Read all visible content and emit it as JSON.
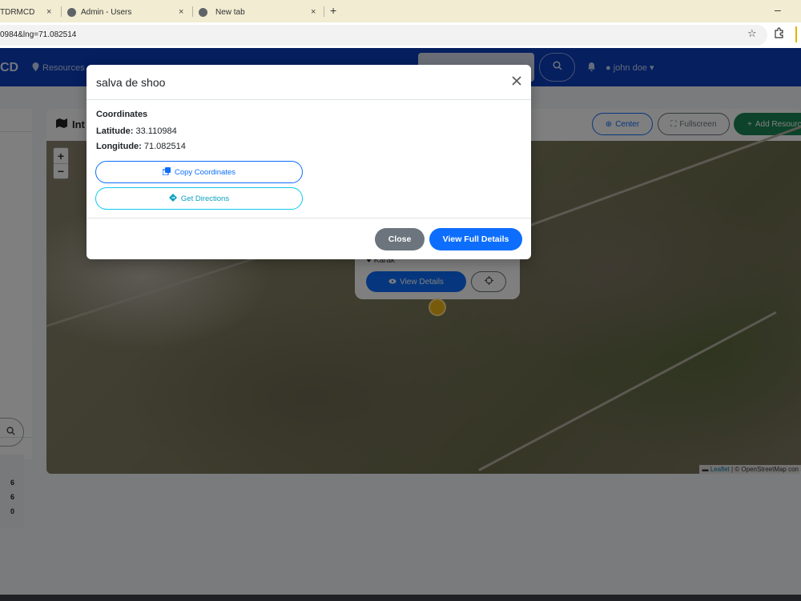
{
  "browser": {
    "tabs": [
      {
        "title": "TDRMCD",
        "color": "#6a7f4a"
      },
      {
        "title": "Admin - Users",
        "color": "#5f6368"
      },
      {
        "title": "New tab",
        "color": "#5f6368"
      }
    ],
    "new_tab_symbol": "+",
    "close_symbol": "×",
    "minimize_symbol": "–",
    "url": "0984&lng=71.082514",
    "bookmark_icon": "star-icon",
    "extensions_icon": "puzzle-icon"
  },
  "navbar": {
    "brand": "CD",
    "resources_label": "Resources",
    "user_label": "john doe",
    "color": "#0b3fbf"
  },
  "map_card": {
    "title": "Int",
    "center_label": "Center",
    "fullscreen_label": "Fullscreen",
    "add_label": "Add Resourc",
    "zoom_in": "+",
    "zoom_out": "−",
    "attribution_leaflet": "Leaflet",
    "attribution_rest": "| © OpenStreetMap con"
  },
  "marker_popup": {
    "location": "Karak",
    "view_details_label": "View Details"
  },
  "sidebar": {
    "stats": [
      "6",
      "6",
      "0"
    ]
  },
  "modal": {
    "title": "salva de shoo",
    "coordinates_heading": "Coordinates",
    "latitude_label": "Latitude:",
    "latitude_value": "33.110984",
    "longitude_label": "Longitude:",
    "longitude_value": "71.082514",
    "copy_label": "Copy Coordinates",
    "directions_label": "Get Directions",
    "close_label": "Close",
    "details_label": "View Full Details"
  },
  "colors": {
    "primary": "#0d6efd",
    "secondary": "#6c757d",
    "info": "#0dcaf0",
    "success": "#198754"
  }
}
